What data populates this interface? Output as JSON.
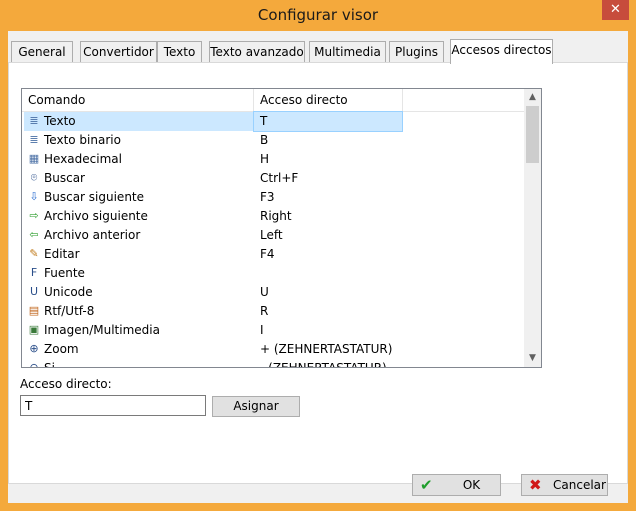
{
  "window": {
    "title": "Configurar visor",
    "close_glyph": "✕"
  },
  "tabs": [
    {
      "label": "General"
    },
    {
      "label": "Convertidor"
    },
    {
      "label": "Texto"
    },
    {
      "label": "Texto avanzado"
    },
    {
      "label": "Multimedia"
    },
    {
      "label": "Plugins"
    },
    {
      "label": "Accesos directos",
      "active": true
    }
  ],
  "list": {
    "columns": {
      "command": "Comando",
      "shortcut": "Acceso directo"
    },
    "rows": [
      {
        "command": "Texto",
        "shortcut": "T",
        "icon": "text-document-icon",
        "glyph": "≣",
        "color": "#4a6fa5",
        "selected": true
      },
      {
        "command": "Texto binario",
        "shortcut": "B",
        "icon": "binary-document-icon",
        "glyph": "≣",
        "color": "#4a6fa5"
      },
      {
        "command": "Hexadecimal",
        "shortcut": "H",
        "icon": "hex-document-icon",
        "glyph": "▦",
        "color": "#4a6fa5"
      },
      {
        "command": "Buscar",
        "shortcut": "Ctrl+F",
        "icon": "binoculars-icon",
        "glyph": "⌾",
        "color": "#2b4f8a"
      },
      {
        "command": "Buscar siguiente",
        "shortcut": "F3",
        "icon": "arrow-down-icon",
        "glyph": "⇩",
        "color": "#2d6fd1"
      },
      {
        "command": "Archivo siguiente",
        "shortcut": "Right",
        "icon": "arrow-right-icon",
        "glyph": "⇨",
        "color": "#2e9e2e"
      },
      {
        "command": "Archivo anterior",
        "shortcut": "Left",
        "icon": "arrow-left-icon",
        "glyph": "⇦",
        "color": "#2e9e2e"
      },
      {
        "command": "Editar",
        "shortcut": "F4",
        "icon": "edit-pencil-icon",
        "glyph": "✎",
        "color": "#c07a1a"
      },
      {
        "command": "Fuente",
        "shortcut": "",
        "icon": "font-icon",
        "glyph": "F",
        "color": "#2b4f8a"
      },
      {
        "command": "Unicode",
        "shortcut": "U",
        "icon": "unicode-icon",
        "glyph": "U",
        "color": "#2b4f8a"
      },
      {
        "command": "Rtf/Utf-8",
        "shortcut": "R",
        "icon": "rtf-icon",
        "glyph": "▤",
        "color": "#c0641a"
      },
      {
        "command": "Imagen/Multimedia",
        "shortcut": "I",
        "icon": "image-icon",
        "glyph": "▣",
        "color": "#3a7a3a"
      },
      {
        "command": "Zoom",
        "shortcut": "+ (ZEHNERTASTATUR)",
        "icon": "zoom-in-icon",
        "glyph": "⊕",
        "color": "#2b4f8a"
      },
      {
        "command": "Si",
        "shortcut": "- (ZEHNERTASTATUR)",
        "icon": "zoom-out-icon",
        "glyph": "⊖",
        "color": "#2b4f8a"
      }
    ]
  },
  "shortcut_editor": {
    "label": "Acceso directo:",
    "value": "T",
    "assign_label": "Asignar"
  },
  "footer": {
    "ok_label": "OK",
    "cancel_label": "Cancelar"
  },
  "colors": {
    "title_bar": "#f4a93c",
    "selection": "#cce8ff",
    "ok_icon": "#1f9e2c",
    "cancel_icon": "#d01818"
  }
}
